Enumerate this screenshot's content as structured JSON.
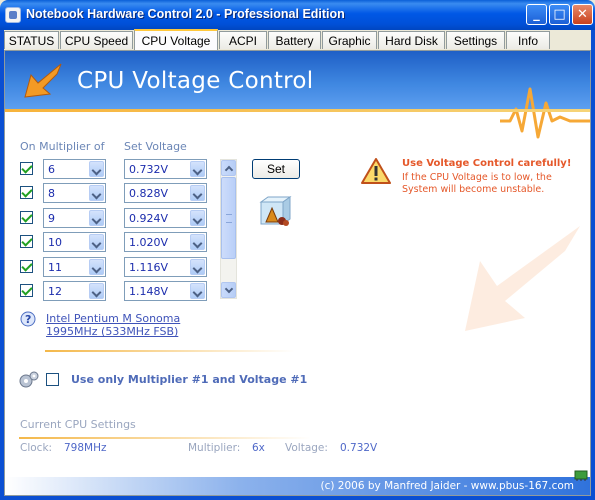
{
  "window": {
    "title": "Notebook Hardware Control 2.0  -  Professional Edition",
    "minimize_glyph": "_",
    "maximize_glyph": "□",
    "close_glyph": "✕"
  },
  "tabs": [
    {
      "label": "STATUS",
      "active": false
    },
    {
      "label": "CPU Speed",
      "active": false
    },
    {
      "label": "CPU Voltage",
      "active": true
    },
    {
      "label": "ACPI",
      "active": false
    },
    {
      "label": "Battery",
      "active": false
    },
    {
      "label": "Graphic",
      "active": false
    },
    {
      "label": "Hard Disk",
      "active": false
    },
    {
      "label": "Settings",
      "active": false
    },
    {
      "label": "Info",
      "active": false
    }
  ],
  "banner": {
    "title": "CPU Voltage Control"
  },
  "table": {
    "multiplier_header": "On Multiplier of",
    "voltage_header": "Set Voltage",
    "rows": [
      {
        "checked": true,
        "multiplier": "6",
        "voltage": "0.732V"
      },
      {
        "checked": true,
        "multiplier": "8",
        "voltage": "0.828V"
      },
      {
        "checked": true,
        "multiplier": "9",
        "voltage": "0.924V"
      },
      {
        "checked": true,
        "multiplier": "10",
        "voltage": "1.020V"
      },
      {
        "checked": true,
        "multiplier": "11",
        "voltage": "1.116V"
      },
      {
        "checked": true,
        "multiplier": "12",
        "voltage": "1.148V"
      }
    ]
  },
  "set_button": "Set",
  "warning": {
    "title": "Use Voltage Control carefully!",
    "text": "If the CPU Voltage is to low, the System will become unstable."
  },
  "cpu_info": {
    "line1": "Intel Pentium M Sonoma",
    "line2": "1995MHz (533MHz FSB)"
  },
  "only_first": {
    "checked": false,
    "label": "Use only Multiplier #1 and Voltage #1"
  },
  "current": {
    "title": "Current CPU Settings",
    "clock_label": "Clock:",
    "clock_value": "798MHz",
    "multiplier_label": "Multiplier:",
    "multiplier_value": "6x",
    "voltage_label": "Voltage:",
    "voltage_value": "0.732V"
  },
  "footer": {
    "text": "(c) 2006 by Manfred Jaider - www.pbus-167.com"
  },
  "colors": {
    "titlebar": "#0058e6",
    "banner": "#3e86e0",
    "accent_orange": "#f7b33b",
    "warning": "#e5582a",
    "value_blue": "#1c2dad"
  }
}
